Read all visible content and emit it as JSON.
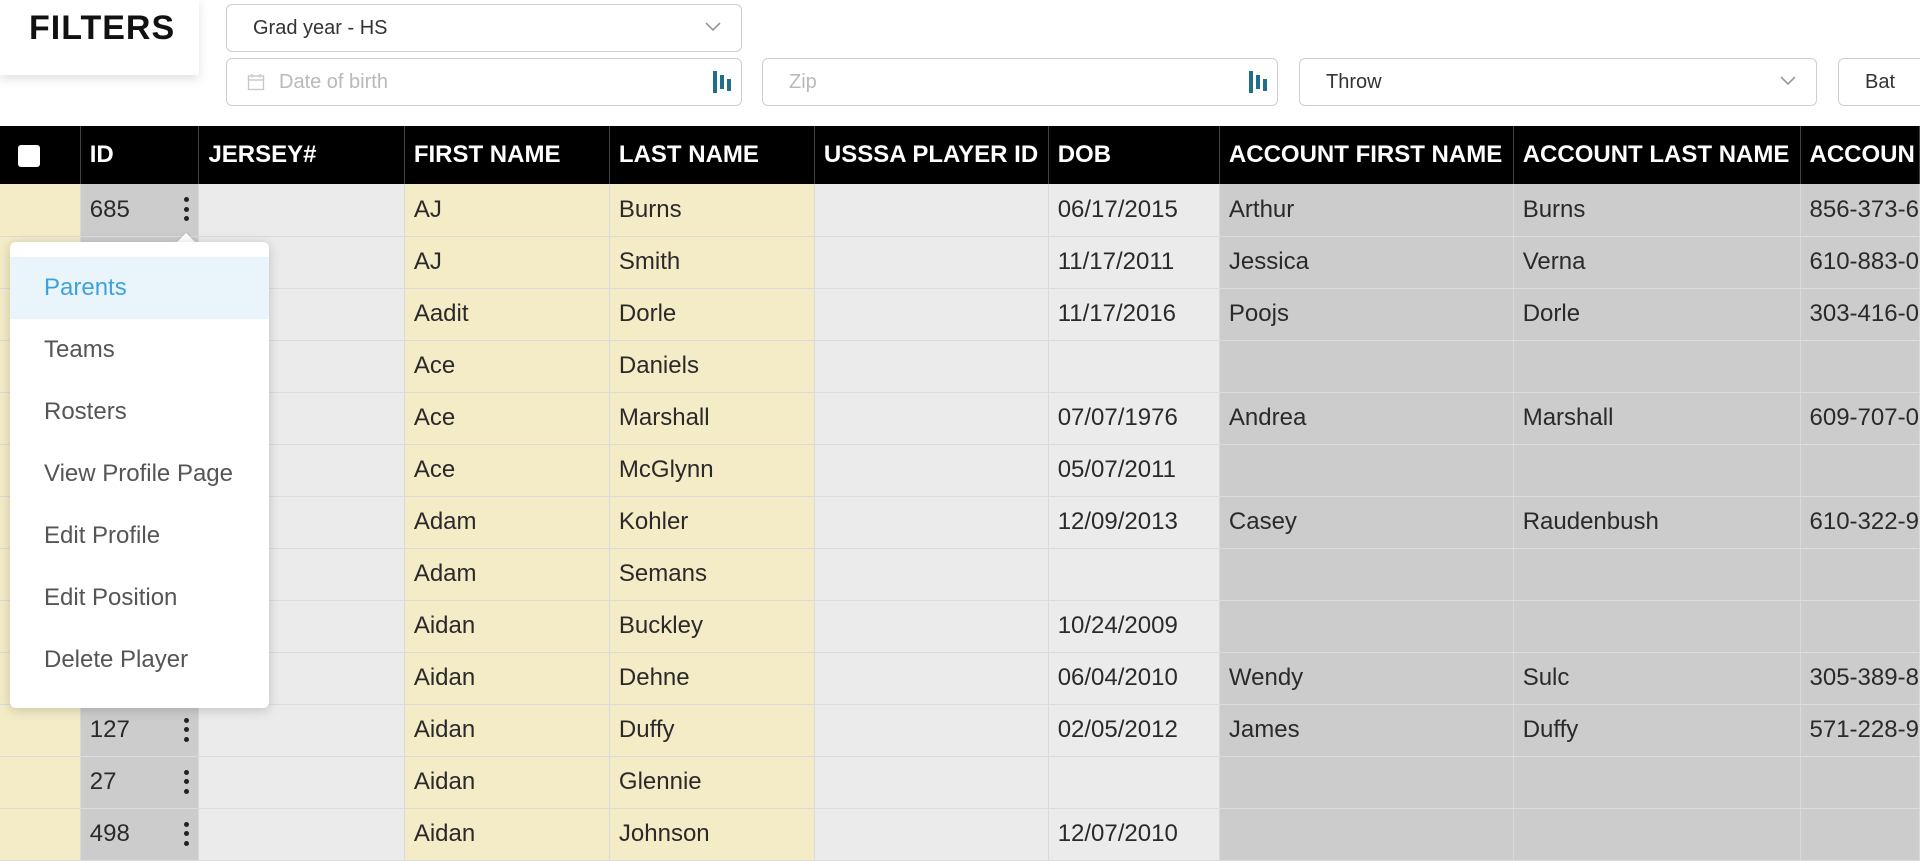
{
  "filters": {
    "title": "FILTERS",
    "grad_year": "Grad year - HS",
    "dob_placeholder": "Date of birth",
    "zip_placeholder": "Zip",
    "throw": "Throw",
    "bat": "Bat"
  },
  "table": {
    "headers": [
      "ID",
      "JERSEY#",
      "FIRST NAME",
      "LAST NAME",
      "USSSA PLAYER ID",
      "DOB",
      "ACCOUNT FIRST NAME",
      "ACCOUNT LAST NAME",
      "ACCOUN"
    ],
    "rows": [
      {
        "id": "685",
        "jersey": "",
        "first": "AJ",
        "last": "Burns",
        "usssa": "",
        "dob": "06/17/2015",
        "acc_first": "Arthur",
        "acc_last": "Burns",
        "acc_phone": "856-373-6"
      },
      {
        "id": "",
        "jersey": "",
        "first": "AJ",
        "last": "Smith",
        "usssa": "",
        "dob": "11/17/2011",
        "acc_first": "Jessica",
        "acc_last": "Verna",
        "acc_phone": "610-883-0"
      },
      {
        "id": "",
        "jersey": "",
        "first": "Aadit",
        "last": "Dorle",
        "usssa": "",
        "dob": "11/17/2016",
        "acc_first": "Poojs",
        "acc_last": "Dorle",
        "acc_phone": "303-416-0"
      },
      {
        "id": "",
        "jersey": "",
        "first": "Ace",
        "last": "Daniels",
        "usssa": "",
        "dob": "",
        "acc_first": "",
        "acc_last": "",
        "acc_phone": ""
      },
      {
        "id": "",
        "jersey": "",
        "first": "Ace",
        "last": "Marshall",
        "usssa": "",
        "dob": "07/07/1976",
        "acc_first": "Andrea",
        "acc_last": "Marshall",
        "acc_phone": "609-707-0"
      },
      {
        "id": "",
        "jersey": "",
        "first": "Ace",
        "last": "McGlynn",
        "usssa": "",
        "dob": "05/07/2011",
        "acc_first": "",
        "acc_last": "",
        "acc_phone": ""
      },
      {
        "id": "",
        "jersey": "",
        "first": "Adam",
        "last": "Kohler",
        "usssa": "",
        "dob": "12/09/2013",
        "acc_first": "Casey",
        "acc_last": "Raudenbush",
        "acc_phone": "610-322-9"
      },
      {
        "id": "",
        "jersey": "",
        "first": "Adam",
        "last": "Semans",
        "usssa": "",
        "dob": "",
        "acc_first": "",
        "acc_last": "",
        "acc_phone": ""
      },
      {
        "id": "",
        "jersey": "",
        "first": "Aidan",
        "last": "Buckley",
        "usssa": "",
        "dob": "10/24/2009",
        "acc_first": "",
        "acc_last": "",
        "acc_phone": ""
      },
      {
        "id": "",
        "jersey": "",
        "first": "Aidan",
        "last": "Dehne",
        "usssa": "",
        "dob": "06/04/2010",
        "acc_first": "Wendy",
        "acc_last": "Sulc",
        "acc_phone": "305-389-8"
      },
      {
        "id": "127",
        "jersey": "",
        "first": "Aidan",
        "last": "Duffy",
        "usssa": "",
        "dob": "02/05/2012",
        "acc_first": "James",
        "acc_last": "Duffy",
        "acc_phone": "571-228-9"
      },
      {
        "id": "27",
        "jersey": "",
        "first": "Aidan",
        "last": "Glennie",
        "usssa": "",
        "dob": "",
        "acc_first": "",
        "acc_last": "",
        "acc_phone": ""
      },
      {
        "id": "498",
        "jersey": "",
        "first": "Aidan",
        "last": "Johnson",
        "usssa": "",
        "dob": "12/07/2010",
        "acc_first": "",
        "acc_last": "",
        "acc_phone": ""
      }
    ]
  },
  "row_menu": {
    "items": [
      "Parents",
      "Teams",
      "Rosters",
      "View Profile Page",
      "Edit Profile",
      "Edit Position",
      "Delete Player"
    ],
    "active": "Parents"
  },
  "colors": {
    "header_bg": "#000000",
    "highlight_col": "#f4ecc6",
    "gray_col": "#cccccc",
    "light_col": "#ebebeb",
    "menu_active": "#3ea3dc"
  },
  "icons": {
    "dropdown": "chevron-down-icon",
    "calendar": "calendar-icon",
    "row_actions": "kebab-menu-icon"
  }
}
